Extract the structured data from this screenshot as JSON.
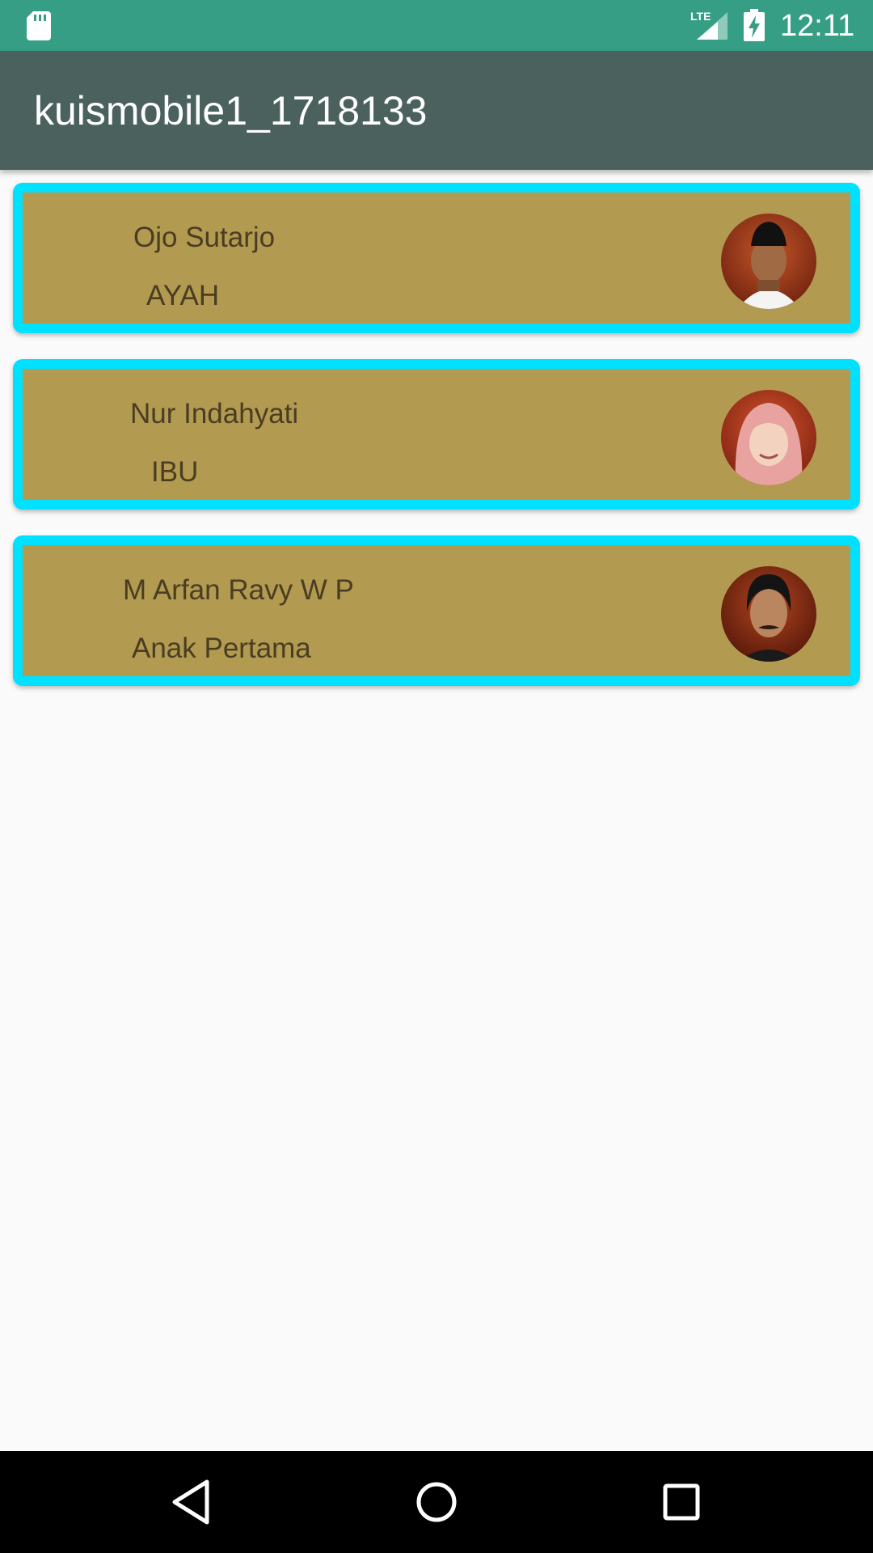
{
  "status_bar": {
    "time": "12:11",
    "network_label": "LTE",
    "icons": [
      "sd-card-icon",
      "lte-signal-icon",
      "battery-charging-icon"
    ]
  },
  "app_bar": {
    "title": "kuismobile1_1718133"
  },
  "family": [
    {
      "name": "Ojo Sutarjo",
      "role": "AYAH",
      "avatar_icon": "avatar-father"
    },
    {
      "name": "Nur Indahyati",
      "role": "IBU",
      "avatar_icon": "avatar-mother"
    },
    {
      "name": "M Arfan Ravy W P",
      "role": "Anak Pertama",
      "avatar_icon": "avatar-first-child"
    }
  ],
  "colors": {
    "status_bar": "#359e84",
    "app_bar": "#4b615e",
    "card_fill": "#b29a51",
    "card_border": "#00e0ff",
    "background": "#fafafa"
  },
  "nav_bar": {
    "buttons": [
      "back-icon",
      "home-icon",
      "recents-icon"
    ]
  }
}
